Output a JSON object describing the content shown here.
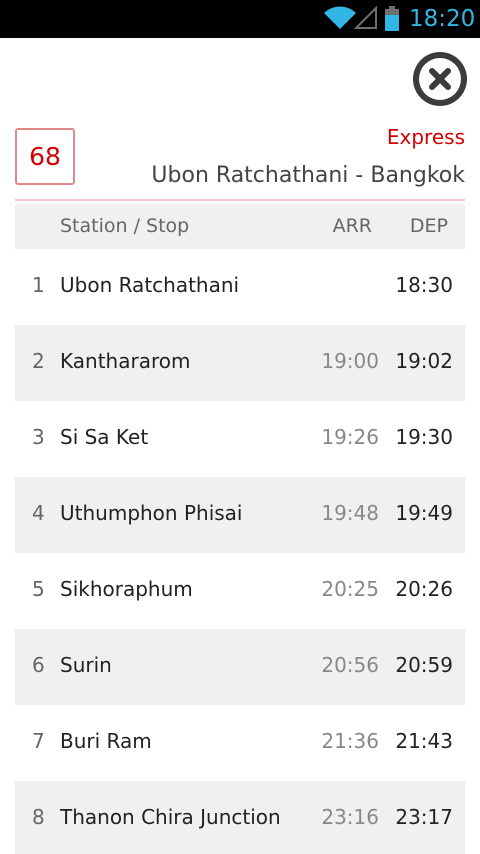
{
  "status_bar": {
    "time": "18:20",
    "icons": [
      "wifi-icon",
      "signal-icon",
      "battery-icon"
    ],
    "accent_color": "#33b5e5"
  },
  "toolbar": {
    "close_icon": "close-icon"
  },
  "train": {
    "number": "68",
    "type": "Express",
    "route": "Ubon Ratchathani - Bangkok",
    "accent_color": "#d40000"
  },
  "table": {
    "headers": {
      "station": "Station / Stop",
      "arr": "ARR",
      "dep": "DEP"
    },
    "rows": [
      {
        "index": "1",
        "station": "Ubon Ratchathani",
        "arr": "",
        "dep": "18:30"
      },
      {
        "index": "2",
        "station": "Kanthararom",
        "arr": "19:00",
        "dep": "19:02"
      },
      {
        "index": "3",
        "station": "Si Sa Ket",
        "arr": "19:26",
        "dep": "19:30"
      },
      {
        "index": "4",
        "station": "Uthumphon Phisai",
        "arr": "19:48",
        "dep": "19:49"
      },
      {
        "index": "5",
        "station": "Sikhoraphum",
        "arr": "20:25",
        "dep": "20:26"
      },
      {
        "index": "6",
        "station": "Surin",
        "arr": "20:56",
        "dep": "20:59"
      },
      {
        "index": "7",
        "station": "Buri Ram",
        "arr": "21:36",
        "dep": "21:43"
      },
      {
        "index": "8",
        "station": "Thanon Chira Junction",
        "arr": "23:16",
        "dep": "23:17"
      }
    ]
  }
}
